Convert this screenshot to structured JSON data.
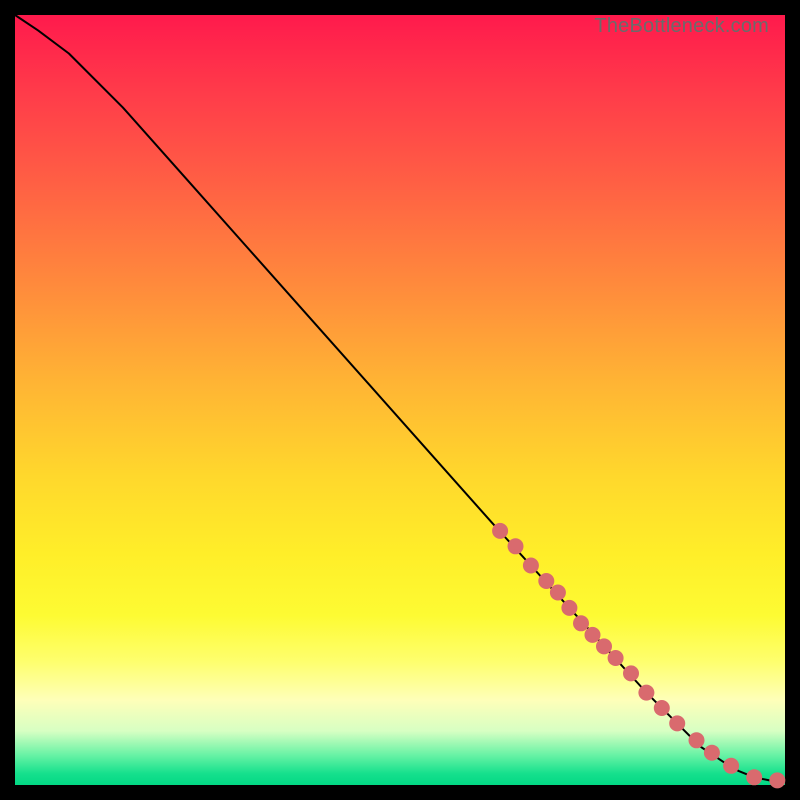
{
  "watermark": "TheBottleneck.com",
  "colors": {
    "frame_bg": "#000000",
    "curve": "#000000",
    "marker": "#d96a6e",
    "gradient_top": "#ff1a4c",
    "gradient_bottom": "#02d884"
  },
  "chart_data": {
    "type": "line",
    "title": "",
    "xlabel": "",
    "ylabel": "",
    "xlim": [
      0,
      100
    ],
    "ylim": [
      0,
      100
    ],
    "grid": false,
    "legend": false,
    "series": [
      {
        "name": "curve",
        "kind": "line",
        "x": [
          0,
          3,
          7,
          14,
          22,
          30,
          38,
          46,
          54,
          62,
          67,
          72,
          77,
          82,
          86,
          89,
          92,
          94,
          96,
          98,
          100
        ],
        "y": [
          100,
          98,
          95,
          88,
          79,
          70,
          61,
          52,
          43,
          34,
          28.5,
          23,
          17.5,
          12,
          8,
          5,
          3,
          1.8,
          1,
          0.6,
          0.5
        ]
      },
      {
        "name": "markers",
        "kind": "scatter",
        "x": [
          63,
          65,
          67,
          69,
          70.5,
          72,
          73.5,
          75,
          76.5,
          78,
          80,
          82,
          84,
          86,
          88.5,
          90.5,
          93,
          96,
          99
        ],
        "y": [
          33,
          31,
          28.5,
          26.5,
          25,
          23,
          21,
          19.5,
          18,
          16.5,
          14.5,
          12,
          10,
          8,
          5.8,
          4.2,
          2.5,
          1,
          0.6
        ]
      }
    ]
  }
}
